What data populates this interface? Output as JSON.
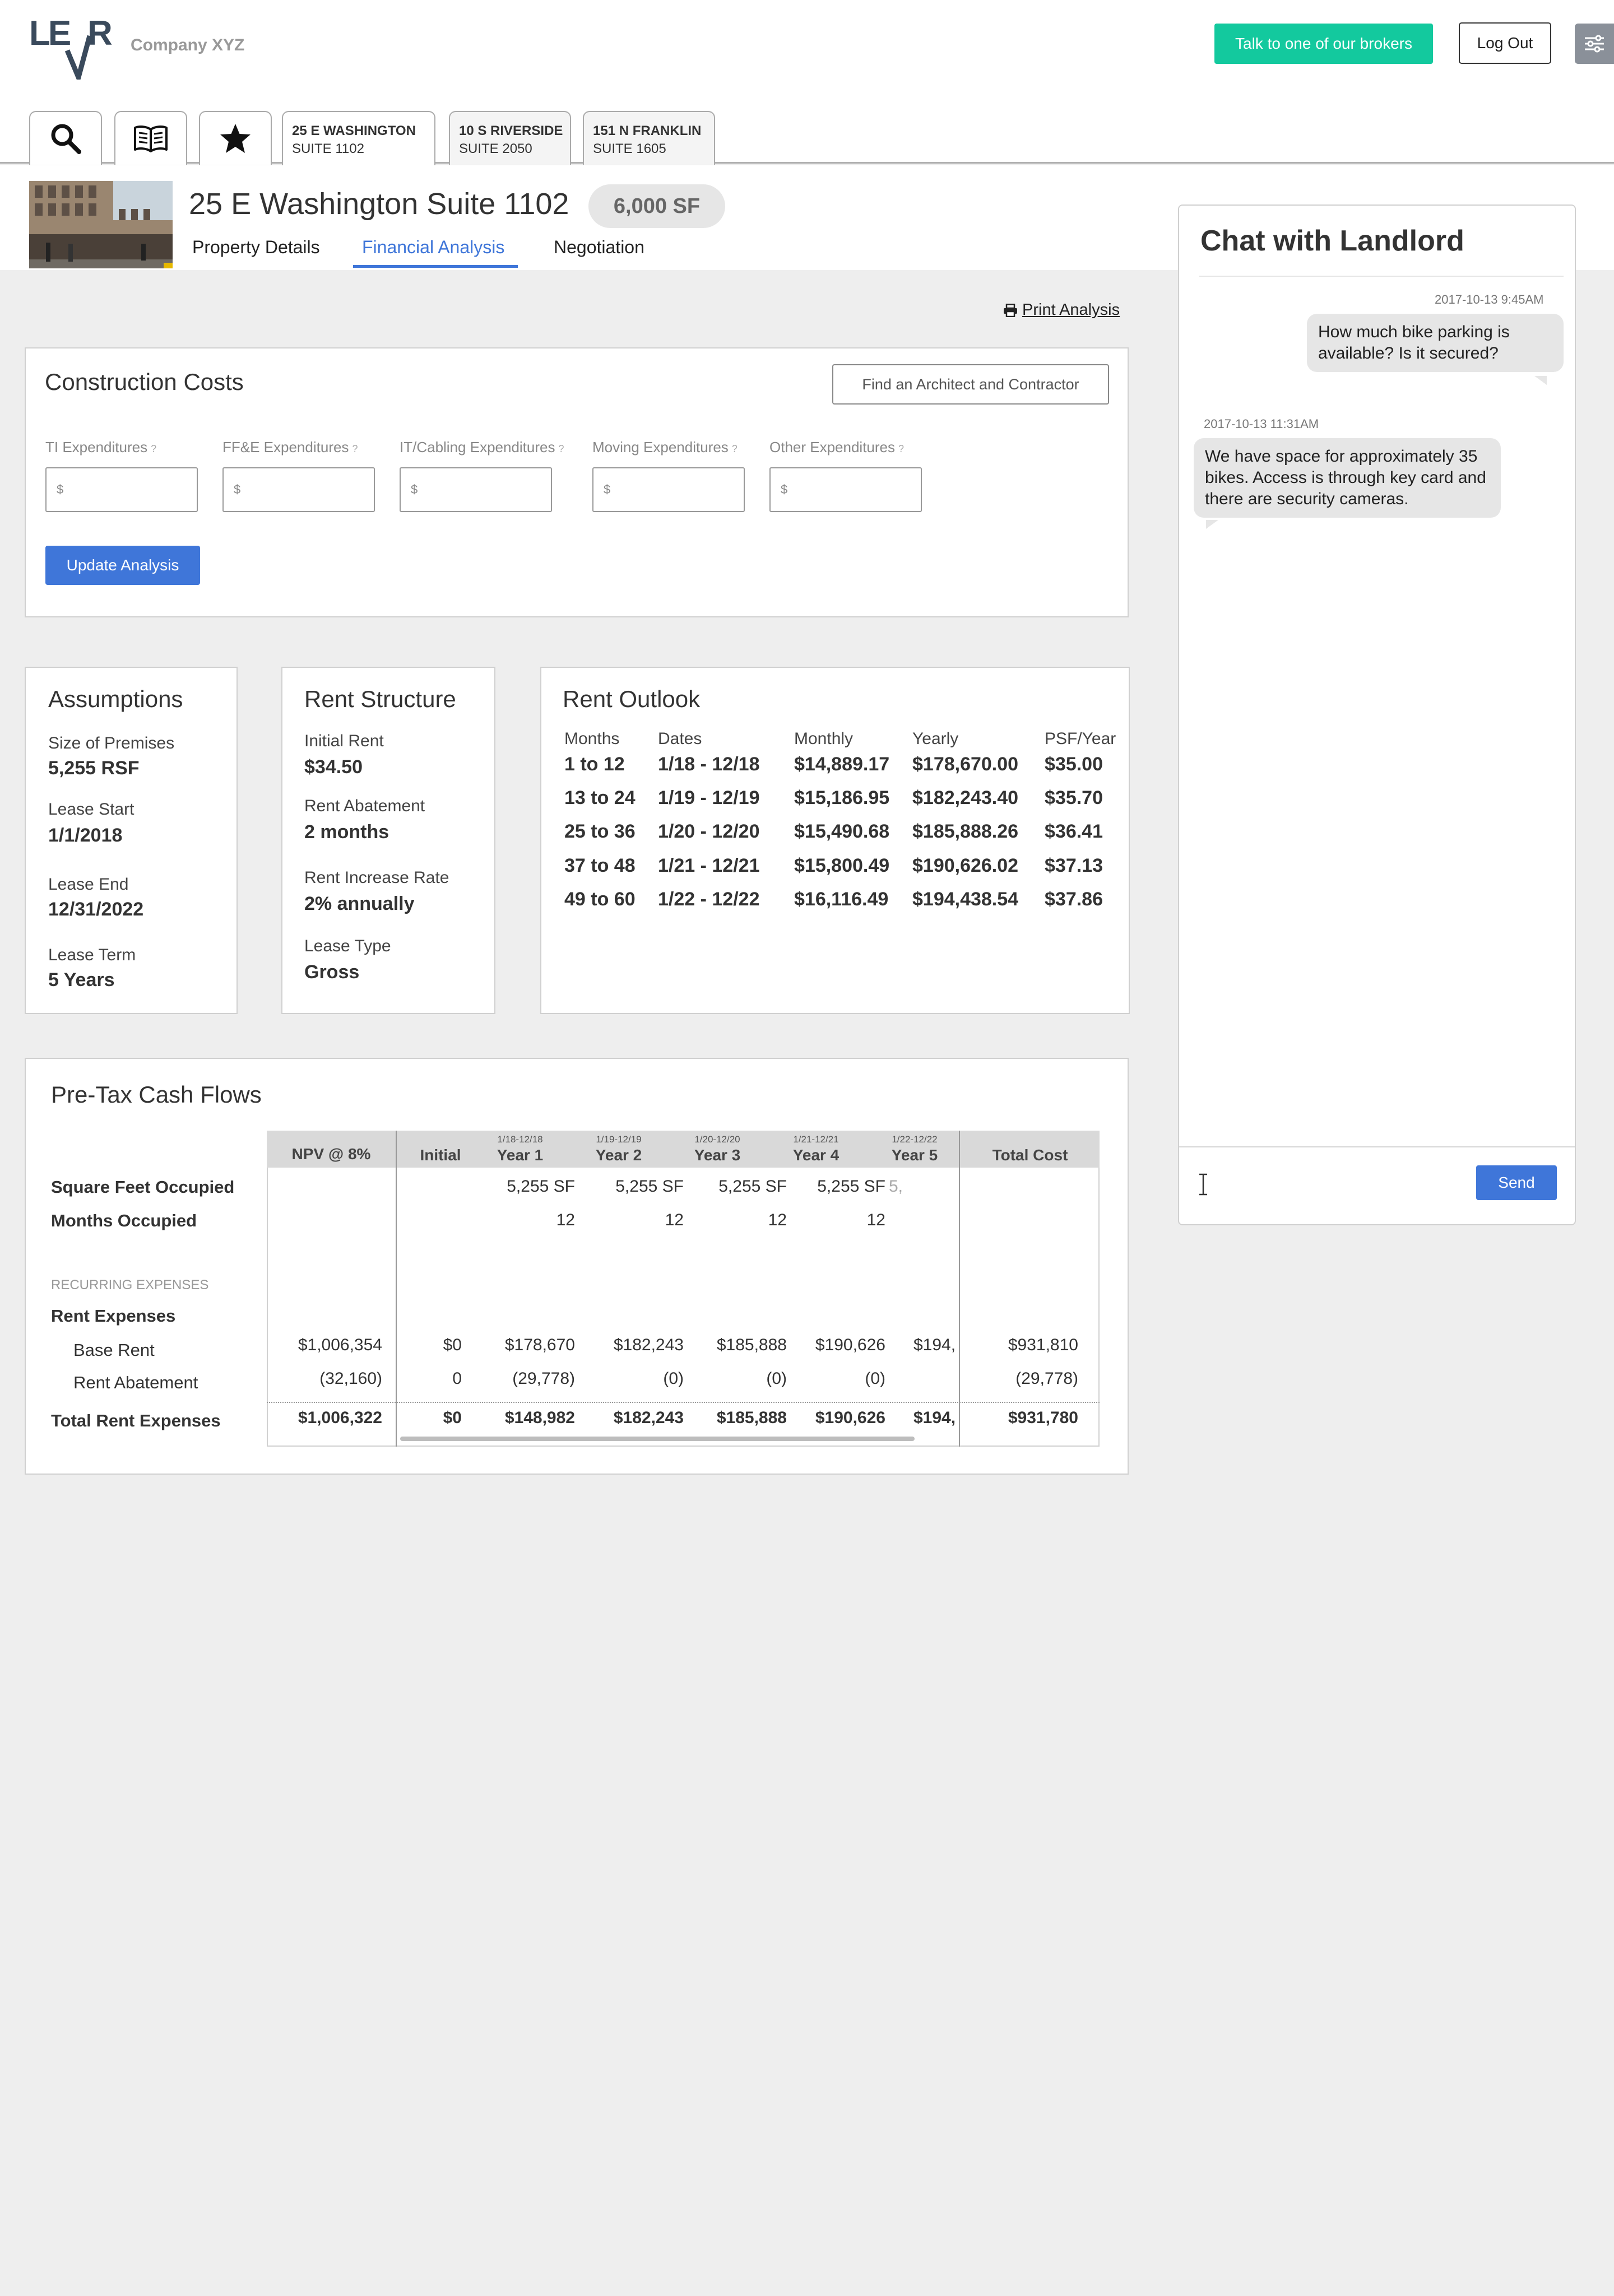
{
  "app": {
    "company": "Company XYZ",
    "logo_text": "LEVR"
  },
  "header": {
    "brokers_button": "Talk to one of our brokers",
    "logout_button": "Log Out"
  },
  "tabs": [
    {
      "line1": "25 E WASHINGTON",
      "line2": "SUITE 1102"
    },
    {
      "line1": "10 S RIVERSIDE",
      "line2": "SUITE 2050"
    },
    {
      "line1": "151 N FRANKLIN",
      "line2": "SUITE 1605"
    }
  ],
  "property": {
    "title": "25 E Washington Suite 1102",
    "size_badge": "6,000 SF",
    "subtabs": [
      "Property Details",
      "Financial Analysis",
      "Negotiation"
    ],
    "active_subtab": "Financial Analysis"
  },
  "print_label": "Print Analysis",
  "construction": {
    "title": "Construction Costs",
    "find_button": "Find an Architect and Contractor",
    "fields": [
      {
        "label": "TI Expenditures",
        "placeholder": "$"
      },
      {
        "label": "FF&E Expenditures",
        "placeholder": "$"
      },
      {
        "label": "IT/Cabling Expenditures",
        "placeholder": "$"
      },
      {
        "label": "Moving Expenditures",
        "placeholder": "$"
      },
      {
        "label": "Other Expenditures",
        "placeholder": "$"
      }
    ],
    "help_mark": "?",
    "update_button": "Update Analysis"
  },
  "assumptions": {
    "title": "Assumptions",
    "items": [
      {
        "label": "Size of Premises",
        "value": "5,255 RSF"
      },
      {
        "label": "Lease Start",
        "value": "1/1/2018"
      },
      {
        "label": "Lease End",
        "value": "12/31/2022"
      },
      {
        "label": "Lease Term",
        "value": "5 Years"
      }
    ]
  },
  "rent_structure": {
    "title": "Rent Structure",
    "items": [
      {
        "label": "Initial Rent",
        "value": "$34.50"
      },
      {
        "label": "Rent Abatement",
        "value": "2 months"
      },
      {
        "label": "Rent Increase Rate",
        "value": "2% annually"
      },
      {
        "label": "Lease Type",
        "value": "Gross"
      }
    ]
  },
  "rent_outlook": {
    "title": "Rent Outlook",
    "headers": [
      "Months",
      "Dates",
      "Monthly",
      "Yearly",
      "PSF/Year"
    ],
    "rows": [
      [
        "1 to 12",
        "1/18 - 12/18",
        "$14,889.17",
        "$178,670.00",
        "$35.00"
      ],
      [
        "13 to 24",
        "1/19 - 12/19",
        "$15,186.95",
        "$182,243.40",
        "$35.70"
      ],
      [
        "25 to 36",
        "1/20 - 12/20",
        "$15,490.68",
        "$185,888.26",
        "$36.41"
      ],
      [
        "37 to 48",
        "1/21 - 12/21",
        "$15,800.49",
        "$190,626.02",
        "$37.13"
      ],
      [
        "49 to 60",
        "1/22 - 12/22",
        "$16,116.49",
        "$194,438.54",
        "$37.86"
      ]
    ]
  },
  "cash_flows": {
    "title": "Pre-Tax Cash Flows",
    "columns": [
      {
        "label": "NPV @ 8%",
        "date": ""
      },
      {
        "label": "Initial",
        "date": ""
      },
      {
        "label": "Year 1",
        "date": "1/18-12/18"
      },
      {
        "label": "Year 2",
        "date": "1/19-12/19"
      },
      {
        "label": "Year 3",
        "date": "1/20-12/20"
      },
      {
        "label": "Year 4",
        "date": "1/21-12/21"
      },
      {
        "label": "Year 5",
        "date": "1/22-12/22"
      },
      {
        "label": "Total Cost",
        "date": ""
      }
    ],
    "row_labels": {
      "sf": "Square Feet Occupied",
      "months": "Months Occupied",
      "section": "RECURRING EXPENSES",
      "rent": "Rent Expenses",
      "base": "Base Rent",
      "abatement": "Rent Abatement",
      "total": "Total Rent Expenses"
    },
    "sf_values": [
      "5,255 SF",
      "5,255 SF",
      "5,255 SF",
      "5,255 SF",
      "5,"
    ],
    "month_values": [
      "12",
      "12",
      "12",
      "12"
    ],
    "base_rent": [
      "$1,006,354",
      "$0",
      "$178,670",
      "$182,243",
      "$185,888",
      "$190,626",
      "$194,",
      "$931,810"
    ],
    "abatement": [
      "(32,160)",
      "0",
      "(29,778)",
      "(0)",
      "(0)",
      "(0)",
      "",
      "(29,778)"
    ],
    "total": [
      "$1,006,322",
      "$0",
      "$148,982",
      "$182,243",
      "$185,888",
      "$190,626",
      "$194,",
      "$931,780"
    ]
  },
  "chat": {
    "title": "Chat with Landlord",
    "messages": [
      {
        "time": "2017-10-13 9:45AM",
        "text": "How much bike parking is available? Is it secured?",
        "side": "right"
      },
      {
        "time": "2017-10-13 11:31AM",
        "text": "We have space for approximately 35 bikes. Access is through key card and there are security cameras.",
        "side": "left"
      }
    ],
    "send_button": "Send"
  },
  "colors": {
    "accent": "#3f76d9",
    "brokers": "#13c99e",
    "logo": "#3a4a5c"
  }
}
